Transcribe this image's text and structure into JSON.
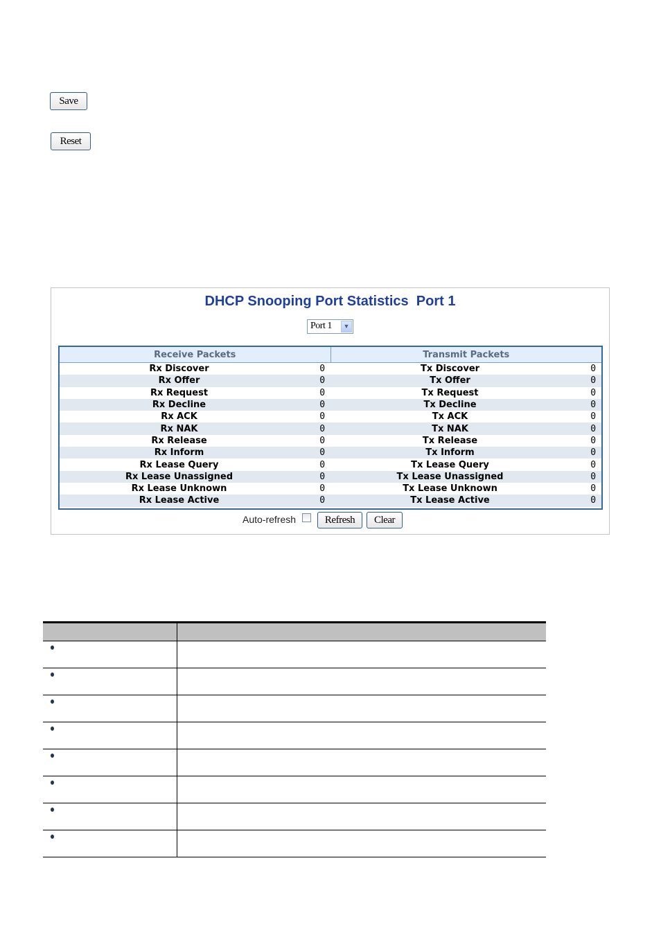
{
  "toolbar": {
    "save_label": "Save",
    "reset_label": "Reset"
  },
  "panel": {
    "title": "DHCP Snooping Port Statistics  Port 1",
    "port_select": {
      "selected": "Port 1",
      "arrow_icon": "chevron-down-icon"
    },
    "stats_table": {
      "headers": [
        "Receive Packets",
        "Transmit Packets"
      ],
      "rows": [
        {
          "rx_label": "Rx Discover",
          "rx_value": "0",
          "tx_label": "Tx Discover",
          "tx_value": "0"
        },
        {
          "rx_label": "Rx Offer",
          "rx_value": "0",
          "tx_label": "Tx Offer",
          "tx_value": "0"
        },
        {
          "rx_label": "Rx Request",
          "rx_value": "0",
          "tx_label": "Tx Request",
          "tx_value": "0"
        },
        {
          "rx_label": "Rx Decline",
          "rx_value": "0",
          "tx_label": "Tx Decline",
          "tx_value": "0"
        },
        {
          "rx_label": "Rx ACK",
          "rx_value": "0",
          "tx_label": "Tx ACK",
          "tx_value": "0"
        },
        {
          "rx_label": "Rx NAK",
          "rx_value": "0",
          "tx_label": "Tx NAK",
          "tx_value": "0"
        },
        {
          "rx_label": "Rx Release",
          "rx_value": "0",
          "tx_label": "Tx Release",
          "tx_value": "0"
        },
        {
          "rx_label": "Rx Inform",
          "rx_value": "0",
          "tx_label": "Tx Inform",
          "tx_value": "0"
        },
        {
          "rx_label": "Rx Lease Query",
          "rx_value": "0",
          "tx_label": "Tx Lease Query",
          "tx_value": "0"
        },
        {
          "rx_label": "Rx Lease Unassigned",
          "rx_value": "0",
          "tx_label": "Tx Lease Unassigned",
          "tx_value": "0"
        },
        {
          "rx_label": "Rx Lease Unknown",
          "rx_value": "0",
          "tx_label": "Tx Lease Unknown",
          "tx_value": "0"
        },
        {
          "rx_label": "Rx Lease Active",
          "rx_value": "0",
          "tx_label": "Tx Lease Active",
          "tx_value": "0"
        }
      ]
    },
    "auto_refresh_label": "Auto-refresh",
    "auto_refresh_checked": false,
    "refresh_label": "Refresh",
    "clear_label": "Clear"
  },
  "description_table": {
    "headers": [
      "",
      ""
    ],
    "rows": [
      {
        "object": "",
        "description": ""
      },
      {
        "object": "",
        "description": ""
      },
      {
        "object": "",
        "description": ""
      },
      {
        "object": "",
        "description": ""
      },
      {
        "object": "",
        "description": ""
      },
      {
        "object": "",
        "description": ""
      },
      {
        "object": "",
        "description": ""
      },
      {
        "object": "",
        "description": ""
      }
    ]
  }
}
